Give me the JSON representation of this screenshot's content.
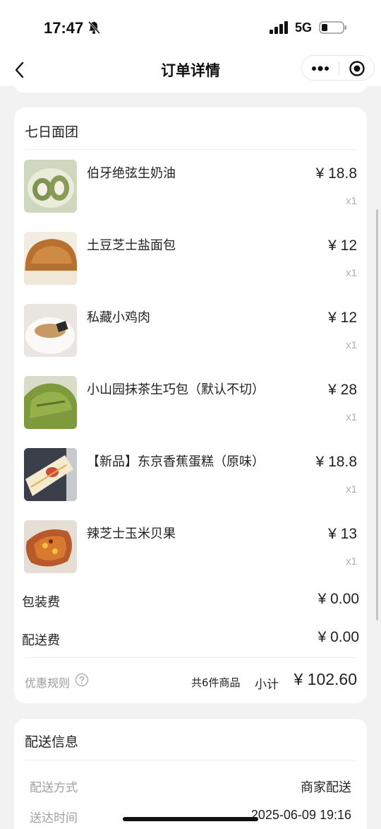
{
  "status_bar": {
    "time": "17:47",
    "network": "5G",
    "icons": [
      "bell-slash-icon",
      "signal-icon",
      "battery-icon"
    ]
  },
  "nav": {
    "title": "订单详情",
    "icons": [
      "back-icon",
      "more-icon",
      "target-icon"
    ]
  },
  "order": {
    "store_name": "七日面团",
    "items": [
      {
        "name": "伯牙绝弦生奶油",
        "price": "¥ 18.8",
        "qty": "x1"
      },
      {
        "name": "土豆芝士盐面包",
        "price": "¥ 12",
        "qty": "x1"
      },
      {
        "name": "私藏小鸡肉",
        "price": "¥ 12",
        "qty": "x1"
      },
      {
        "name": "小山园抹茶生巧包（默认不切）",
        "price": "¥ 28",
        "qty": "x1"
      },
      {
        "name": "【新品】东京香蕉蛋糕（原味）",
        "price": "¥ 18.8",
        "qty": "x1"
      },
      {
        "name": "辣芝士玉米贝果",
        "price": "¥ 13",
        "qty": "x1"
      }
    ],
    "packaging_label": "包装费",
    "packaging_value": "¥ 0.00",
    "delivery_fee_label": "配送费",
    "delivery_fee_value": "¥ 0.00",
    "discount_rules": "优惠规则",
    "item_count": "共6件商品",
    "subtotal_label": "小计",
    "subtotal_value": "¥ 102.60"
  },
  "delivery": {
    "title": "配送信息",
    "rows": [
      {
        "label": "配送方式",
        "value": "商家配送"
      },
      {
        "label": "送达时间",
        "value": "2025-06-09 19:16"
      }
    ]
  },
  "colors": {
    "background": "#f2f2f2",
    "card": "#ffffff",
    "muted": "#b0b0b0"
  }
}
